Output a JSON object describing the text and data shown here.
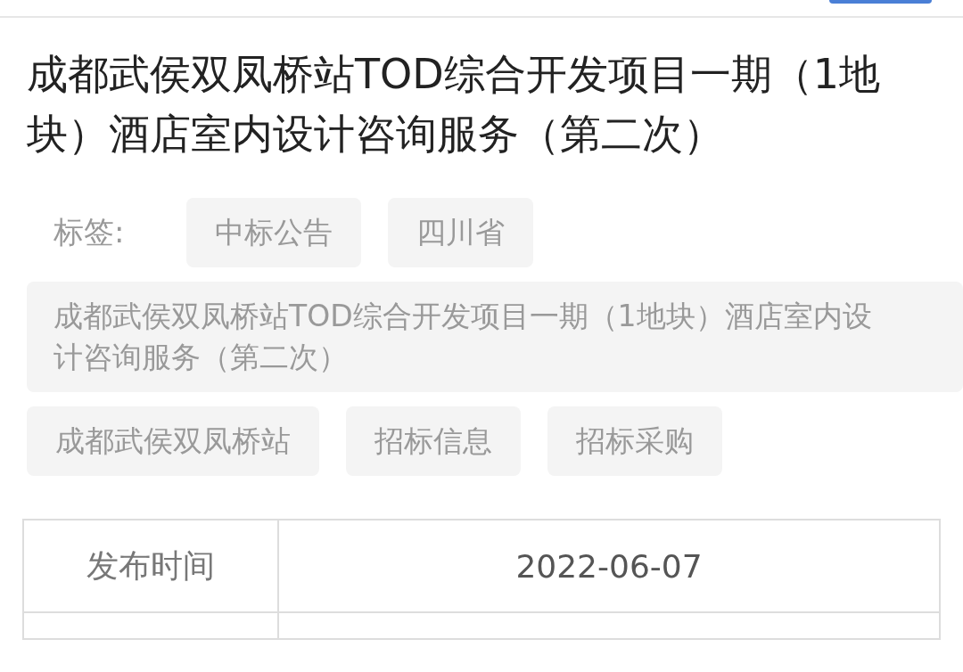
{
  "title": "成都武侯双凤桥站TOD综合开发项目一期（1地块）酒店室内设计咨询服务（第二次）",
  "tags_label": "标签:",
  "tags": [
    "中标公告",
    "四川省",
    "成都武侯双凤桥站TOD综合开发项目一期（1地块）酒店室内设计咨询服务（第二次）",
    "成都武侯双凤桥站",
    "招标信息",
    "招标采购"
  ],
  "table": {
    "rows": [
      {
        "label": "发布时间",
        "value": "2022-06-07"
      }
    ]
  }
}
